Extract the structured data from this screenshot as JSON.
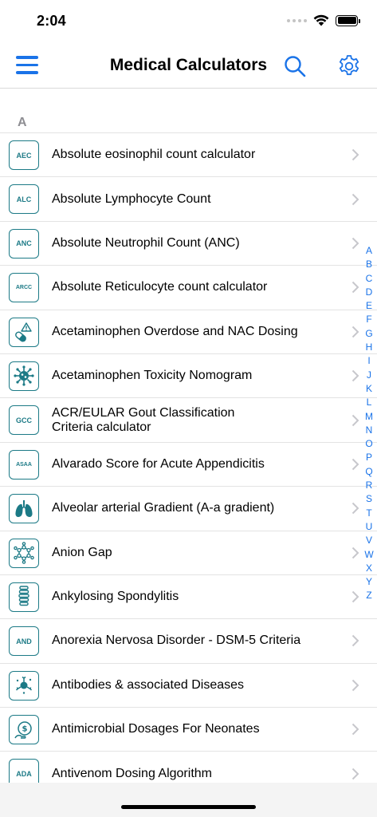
{
  "status_bar": {
    "time": "2:04"
  },
  "nav": {
    "title": "Medical Calculators",
    "accent_color": "#1a73e8"
  },
  "list": {
    "section_letter": "A",
    "items": [
      {
        "label": "Absolute eosinophil count calculator",
        "icon": "AEC"
      },
      {
        "label": "Absolute Lymphocyte Count",
        "icon": "ALC"
      },
      {
        "label": "Absolute Neutrophil Count (ANC)",
        "icon": "ANC"
      },
      {
        "label": "Absolute Reticulocyte count calculator",
        "icon": "ARCC"
      },
      {
        "label": "Acetaminophen Overdose and NAC Dosing",
        "icon": "pill-warning-icon"
      },
      {
        "label": "Acetaminophen Toxicity Nomogram",
        "icon": "virus-icon"
      },
      {
        "label": "ACR/EULAR Gout Classification\nCriteria calculator",
        "icon": "GCC"
      },
      {
        "label": "Alvarado Score for Acute Appendicitis",
        "icon": "ASAA"
      },
      {
        "label": "Alveolar arterial Gradient (A-a gradient)",
        "icon": "lungs-icon"
      },
      {
        "label": "Anion Gap",
        "icon": "molecule-icon"
      },
      {
        "label": "Ankylosing Spondylitis",
        "icon": "spine-icon"
      },
      {
        "label": "Anorexia Nervosa Disorder - DSM-5 Criteria",
        "icon": "AND"
      },
      {
        "label": "Antibodies & associated Diseases",
        "icon": "antibody-icon"
      },
      {
        "label": "Antimicrobial Dosages For Neonates",
        "icon": "dosage-icon"
      },
      {
        "label": "Antivenom Dosing Algorithm",
        "icon": "ADA"
      }
    ]
  },
  "index_letters": [
    "A",
    "B",
    "C",
    "D",
    "E",
    "F",
    "G",
    "H",
    "I",
    "J",
    "K",
    "L",
    "M",
    "N",
    "O",
    "P",
    "Q",
    "R",
    "S",
    "T",
    "U",
    "V",
    "W",
    "X",
    "Y",
    "Z"
  ]
}
